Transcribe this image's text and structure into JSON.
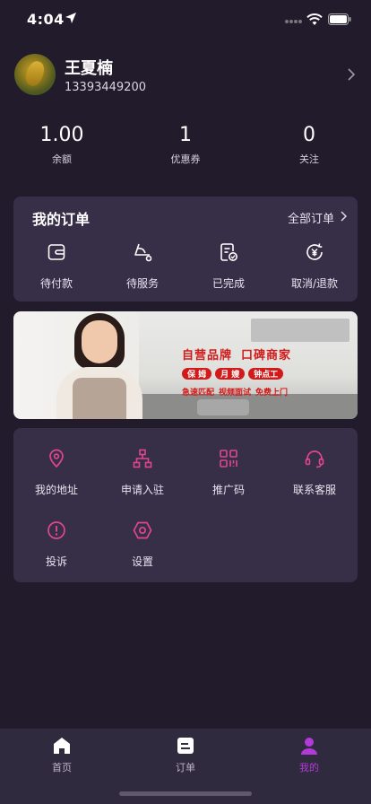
{
  "status_bar": {
    "time": "4:04"
  },
  "profile": {
    "name": "王夏楠",
    "phone": "13393449200"
  },
  "stats": [
    {
      "value": "1.00",
      "label": "余额"
    },
    {
      "value": "1",
      "label": "优惠券"
    },
    {
      "value": "0",
      "label": "关注"
    }
  ],
  "orders": {
    "title": "我的订单",
    "all_label": "全部订单",
    "items": [
      {
        "label": "待付款",
        "icon": "wallet-icon"
      },
      {
        "label": "待服务",
        "icon": "service-icon"
      },
      {
        "label": "已完成",
        "icon": "completed-icon"
      },
      {
        "label": "取消/退款",
        "icon": "refund-icon"
      }
    ]
  },
  "banner": {
    "headline": [
      "自营品牌",
      "口碑商家"
    ],
    "tags": [
      "保 姆",
      "月 嫂",
      "钟点工"
    ],
    "subline": [
      "急速匹配",
      "视频面试",
      "免费上门"
    ]
  },
  "tools": [
    {
      "label": "我的地址",
      "icon": "location-icon"
    },
    {
      "label": "申请入驻",
      "icon": "org-chart-icon"
    },
    {
      "label": "推广码",
      "icon": "qrcode-icon"
    },
    {
      "label": "联系客服",
      "icon": "headset-icon"
    },
    {
      "label": "投诉",
      "icon": "alert-icon"
    },
    {
      "label": "设置",
      "icon": "settings-icon"
    }
  ],
  "tabbar": [
    {
      "label": "首页",
      "icon": "home-icon"
    },
    {
      "label": "订单",
      "icon": "orders-icon"
    },
    {
      "label": "我的",
      "icon": "user-icon",
      "active": true
    }
  ],
  "colors": {
    "background": "#221b2c",
    "card": "#362f47",
    "accent_pink": "#e0468f",
    "active_purple": "#b23ad9"
  }
}
